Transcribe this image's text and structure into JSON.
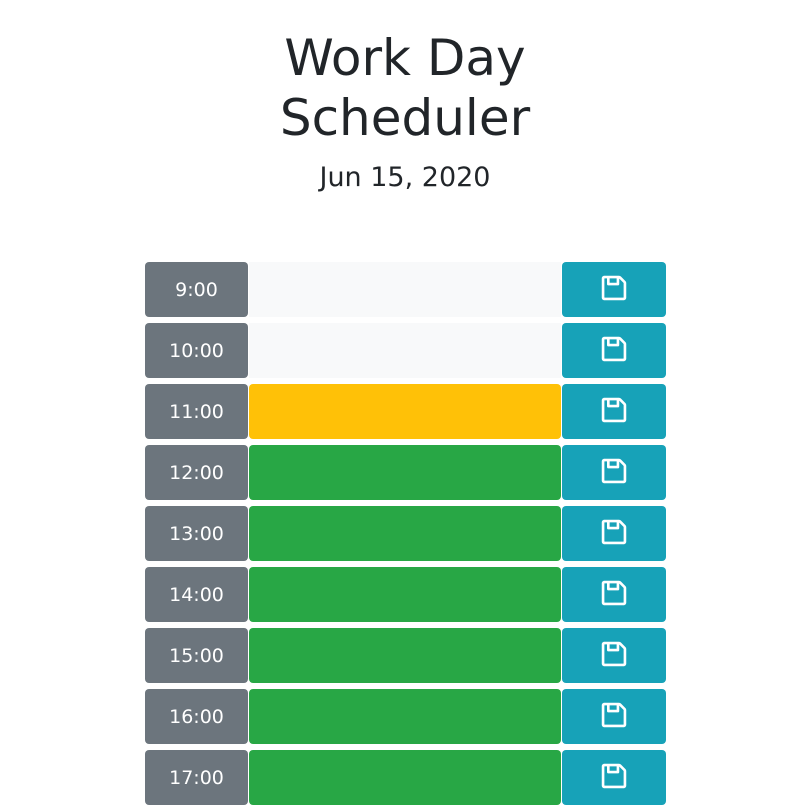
{
  "header": {
    "title": "Work Day Scheduler",
    "date": "Jun 15, 2020"
  },
  "colors": {
    "hour": "#6c757d",
    "past": "#f8f9fa",
    "present": "#ffc107",
    "future": "#28a745",
    "save": "#17a2b8"
  },
  "rows": [
    {
      "hour": "9:00",
      "status": "past",
      "text": "",
      "save_icon": "floppy-disk-icon"
    },
    {
      "hour": "10:00",
      "status": "past",
      "text": "",
      "save_icon": "floppy-disk-icon"
    },
    {
      "hour": "11:00",
      "status": "present",
      "text": "",
      "save_icon": "floppy-disk-icon"
    },
    {
      "hour": "12:00",
      "status": "future",
      "text": "",
      "save_icon": "floppy-disk-icon"
    },
    {
      "hour": "13:00",
      "status": "future",
      "text": "",
      "save_icon": "floppy-disk-icon"
    },
    {
      "hour": "14:00",
      "status": "future",
      "text": "",
      "save_icon": "floppy-disk-icon"
    },
    {
      "hour": "15:00",
      "status": "future",
      "text": "",
      "save_icon": "floppy-disk-icon"
    },
    {
      "hour": "16:00",
      "status": "future",
      "text": "",
      "save_icon": "floppy-disk-icon"
    },
    {
      "hour": "17:00",
      "status": "future",
      "text": "",
      "save_icon": "floppy-disk-icon"
    }
  ]
}
